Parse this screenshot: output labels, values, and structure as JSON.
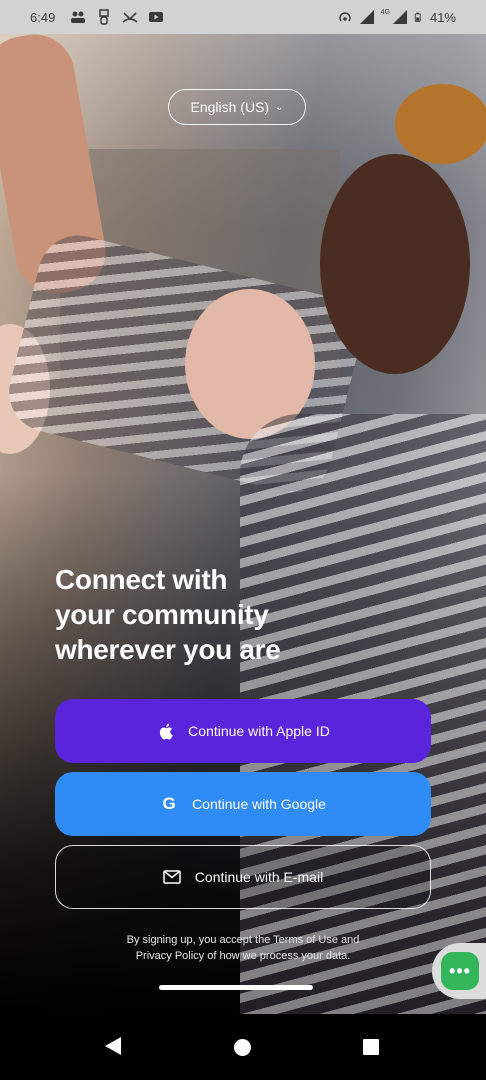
{
  "status_bar": {
    "time": "6:49",
    "battery": "41%",
    "network": "4G",
    "icons_left": [
      "people-icon",
      "usb-icon",
      "missed-call-icon",
      "youtube-icon"
    ],
    "icons_right": [
      "hotspot-icon",
      "signal-icon",
      "signal-4g-icon",
      "battery-icon"
    ]
  },
  "language": {
    "label": "English (US)"
  },
  "headline": {
    "line1": "Connect with",
    "line2": "your community",
    "line3": "wherever you are"
  },
  "buttons": {
    "apple": {
      "label": "Continue with Apple ID",
      "icon": "apple-icon",
      "color": "#5a23dc"
    },
    "google": {
      "label": "Continue with Google",
      "icon": "google-icon",
      "color": "#2f8bf5"
    },
    "email": {
      "label": "Continue with E-mail",
      "icon": "mail-icon"
    }
  },
  "legal": {
    "line1": "By signing up, you accept the Terms of Use and",
    "line2": "Privacy Policy of how we process your data."
  },
  "chat": {
    "icon": "chat-more-icon",
    "color": "#33b55a"
  },
  "nav": {
    "back_icon": "back-triangle-icon",
    "home_icon": "home-circle-icon",
    "recents_icon": "recents-square-icon"
  }
}
